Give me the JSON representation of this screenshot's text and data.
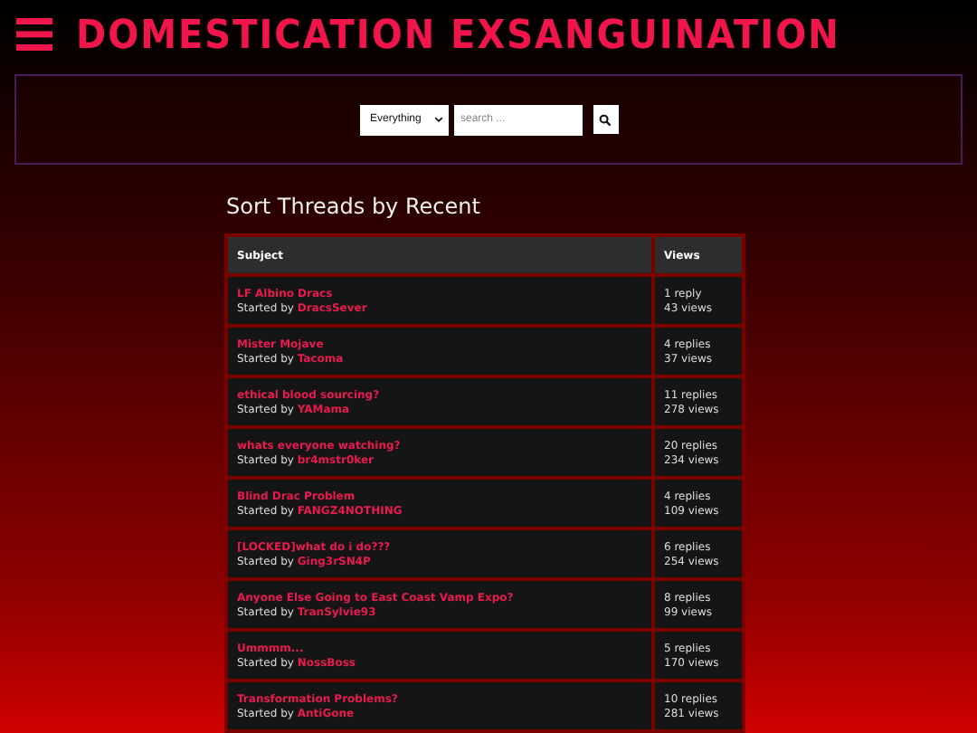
{
  "site": {
    "title": "DOMESTICATION EXSANGUINATION"
  },
  "search": {
    "scope": "Everything",
    "placeholder": "search ..."
  },
  "heading": "Sort Threads by Recent",
  "table": {
    "columns": [
      "Subject",
      "Views"
    ],
    "rows": [
      {
        "subject": "LF Albino Dracs",
        "started_by": "Started by",
        "author": "DracsSever",
        "replies": "1 reply",
        "views": "43 views"
      },
      {
        "subject": "Mister Mojave",
        "started_by": "Started by",
        "author": "Tacoma",
        "replies": "4 replies",
        "views": "37 views"
      },
      {
        "subject": "ethical blood sourcing?",
        "started_by": "Started by",
        "author": "YAMama",
        "replies": "11 replies",
        "views": "278 views"
      },
      {
        "subject": "whats everyone watching?",
        "started_by": "Started by",
        "author": "br4mstr0ker",
        "replies": "20 replies",
        "views": "234 views"
      },
      {
        "subject": "Blind Drac Problem",
        "started_by": "Started by",
        "author": "FANGZ4NOTHING",
        "replies": "4 replies",
        "views": "109 views"
      },
      {
        "subject": "[LOCKED]what do i do???",
        "started_by": "Started by",
        "author": "Ging3rSN4P",
        "replies": "6 replies",
        "views": "254 views"
      },
      {
        "subject": "Anyone Else Going to East Coast Vamp Expo?",
        "started_by": "Started by",
        "author": "TranSylvie93",
        "replies": "8 replies",
        "views": "99 views"
      },
      {
        "subject": "Ummmm...",
        "started_by": "Started by",
        "author": "NossBoss",
        "replies": "5 replies",
        "views": "170 views"
      },
      {
        "subject": "Transformation Problems?",
        "started_by": "Started by",
        "author": "AntiGone",
        "replies": "10 replies",
        "views": "281 views"
      }
    ]
  }
}
